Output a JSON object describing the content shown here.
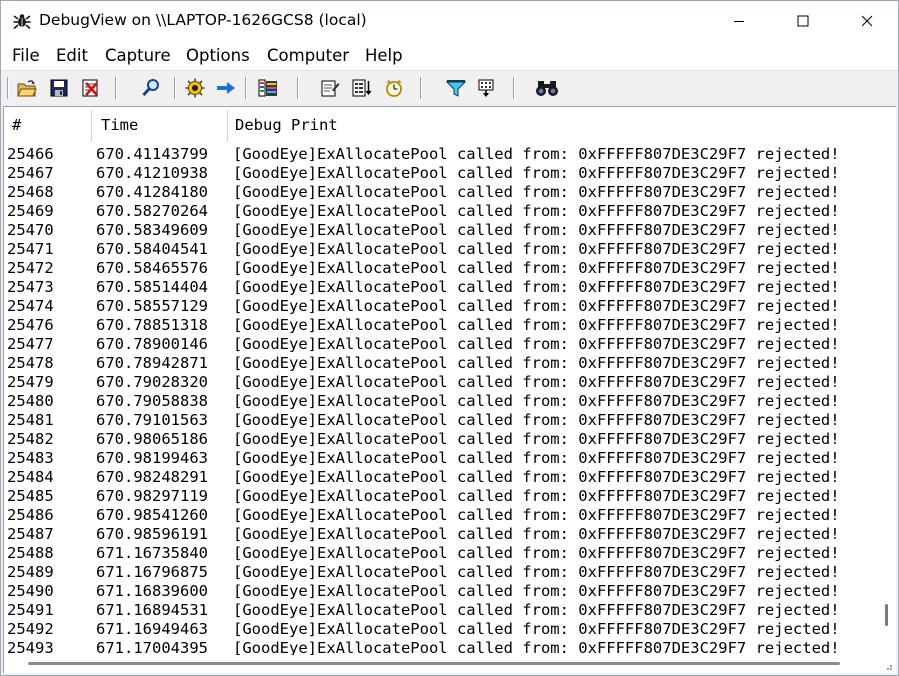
{
  "window": {
    "title": "DebugView on \\\\LAPTOP-1626GCS8 (local)"
  },
  "caption_buttons": {
    "minimize": "minimize-icon",
    "maximize": "maximize-icon",
    "close": "close-icon"
  },
  "menu": {
    "file": "File",
    "edit": "Edit",
    "capture": "Capture",
    "options": "Options",
    "computer": "Computer",
    "help": "Help"
  },
  "toolbar": {
    "icons": [
      "open-folder-icon",
      "save-icon",
      "clear-display-icon",
      "find-icon",
      "capture-icon",
      "autoscroll-arrow-icon",
      "highlight-icon",
      "history-icon",
      "time-format-icon",
      "clock-icon",
      "filter-icon",
      "log-boot-icon",
      "search-binoculars-icon"
    ]
  },
  "columns": {
    "num": "#",
    "time": "Time",
    "debug_print": "Debug Print"
  },
  "rows": [
    {
      "num": "25466",
      "time": "670.41143799",
      "msg": "[GoodEye]ExAllocatePool called from: 0xFFFFF807DE3C29F7 rejected!"
    },
    {
      "num": "25467",
      "time": "670.41210938",
      "msg": "[GoodEye]ExAllocatePool called from: 0xFFFFF807DE3C29F7 rejected!"
    },
    {
      "num": "25468",
      "time": "670.41284180",
      "msg": "[GoodEye]ExAllocatePool called from: 0xFFFFF807DE3C29F7 rejected!"
    },
    {
      "num": "25469",
      "time": "670.58270264",
      "msg": "[GoodEye]ExAllocatePool called from: 0xFFFFF807DE3C29F7 rejected!"
    },
    {
      "num": "25470",
      "time": "670.58349609",
      "msg": "[GoodEye]ExAllocatePool called from: 0xFFFFF807DE3C29F7 rejected!"
    },
    {
      "num": "25471",
      "time": "670.58404541",
      "msg": "[GoodEye]ExAllocatePool called from: 0xFFFFF807DE3C29F7 rejected!"
    },
    {
      "num": "25472",
      "time": "670.58465576",
      "msg": "[GoodEye]ExAllocatePool called from: 0xFFFFF807DE3C29F7 rejected!"
    },
    {
      "num": "25473",
      "time": "670.58514404",
      "msg": "[GoodEye]ExAllocatePool called from: 0xFFFFF807DE3C29F7 rejected!"
    },
    {
      "num": "25474",
      "time": "670.58557129",
      "msg": "[GoodEye]ExAllocatePool called from: 0xFFFFF807DE3C29F7 rejected!"
    },
    {
      "num": "25476",
      "time": "670.78851318",
      "msg": "[GoodEye]ExAllocatePool called from: 0xFFFFF807DE3C29F7 rejected!"
    },
    {
      "num": "25477",
      "time": "670.78900146",
      "msg": "[GoodEye]ExAllocatePool called from: 0xFFFFF807DE3C29F7 rejected!"
    },
    {
      "num": "25478",
      "time": "670.78942871",
      "msg": "[GoodEye]ExAllocatePool called from: 0xFFFFF807DE3C29F7 rejected!"
    },
    {
      "num": "25479",
      "time": "670.79028320",
      "msg": "[GoodEye]ExAllocatePool called from: 0xFFFFF807DE3C29F7 rejected!"
    },
    {
      "num": "25480",
      "time": "670.79058838",
      "msg": "[GoodEye]ExAllocatePool called from: 0xFFFFF807DE3C29F7 rejected!"
    },
    {
      "num": "25481",
      "time": "670.79101563",
      "msg": "[GoodEye]ExAllocatePool called from: 0xFFFFF807DE3C29F7 rejected!"
    },
    {
      "num": "25482",
      "time": "670.98065186",
      "msg": "[GoodEye]ExAllocatePool called from: 0xFFFFF807DE3C29F7 rejected!"
    },
    {
      "num": "25483",
      "time": "670.98199463",
      "msg": "[GoodEye]ExAllocatePool called from: 0xFFFFF807DE3C29F7 rejected!"
    },
    {
      "num": "25484",
      "time": "670.98248291",
      "msg": "[GoodEye]ExAllocatePool called from: 0xFFFFF807DE3C29F7 rejected!"
    },
    {
      "num": "25485",
      "time": "670.98297119",
      "msg": "[GoodEye]ExAllocatePool called from: 0xFFFFF807DE3C29F7 rejected!"
    },
    {
      "num": "25486",
      "time": "670.98541260",
      "msg": "[GoodEye]ExAllocatePool called from: 0xFFFFF807DE3C29F7 rejected!"
    },
    {
      "num": "25487",
      "time": "670.98596191",
      "msg": "[GoodEye]ExAllocatePool called from: 0xFFFFF807DE3C29F7 rejected!"
    },
    {
      "num": "25488",
      "time": "671.16735840",
      "msg": "[GoodEye]ExAllocatePool called from: 0xFFFFF807DE3C29F7 rejected!"
    },
    {
      "num": "25489",
      "time": "671.16796875",
      "msg": "[GoodEye]ExAllocatePool called from: 0xFFFFF807DE3C29F7 rejected!"
    },
    {
      "num": "25490",
      "time": "671.16839600",
      "msg": "[GoodEye]ExAllocatePool called from: 0xFFFFF807DE3C29F7 rejected!"
    },
    {
      "num": "25491",
      "time": "671.16894531",
      "msg": "[GoodEye]ExAllocatePool called from: 0xFFFFF807DE3C29F7 rejected!"
    },
    {
      "num": "25492",
      "time": "671.16949463",
      "msg": "[GoodEye]ExAllocatePool called from: 0xFFFFF807DE3C29F7 rejected!"
    },
    {
      "num": "25493",
      "time": "671.17004395",
      "msg": "[GoodEye]ExAllocatePool called from: 0xFFFFF807DE3C29F7 rejected!"
    }
  ],
  "colors": {
    "title_bg": "#ffffff",
    "chrome_bg": "#f0f0f0",
    "list_bg": "#ffffff",
    "text": "#000000"
  }
}
